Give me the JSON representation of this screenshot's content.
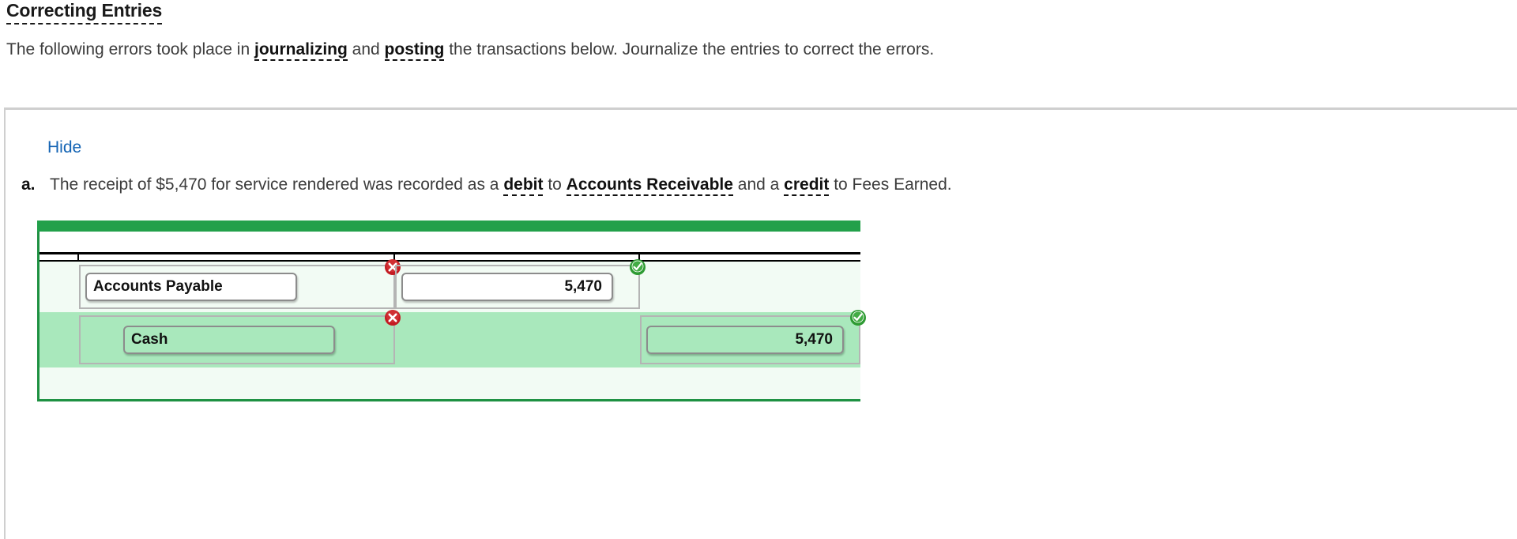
{
  "header": {
    "title": "Correcting Entries",
    "intro_parts": [
      {
        "text": "The following errors took place in ",
        "bold": false
      },
      {
        "text": "journalizing",
        "bold": true
      },
      {
        "text": " and ",
        "bold": false
      },
      {
        "text": "posting",
        "bold": true
      },
      {
        "text": " the transactions below. Journalize the entries to correct the errors.",
        "bold": false
      }
    ]
  },
  "panel": {
    "hide_label": "Hide",
    "item": {
      "marker": "a.",
      "parts": [
        {
          "text": "The receipt of $5,470 for service rendered was recorded as a ",
          "bold": false
        },
        {
          "text": "debit",
          "bold": true
        },
        {
          "text": " to ",
          "bold": false
        },
        {
          "text": "Accounts Receivable",
          "bold": true
        },
        {
          "text": " and a ",
          "bold": false
        },
        {
          "text": "credit",
          "bold": true
        },
        {
          "text": " to Fees Earned.",
          "bold": false
        }
      ]
    }
  },
  "journal": {
    "columns": [
      "",
      "",
      "",
      ""
    ],
    "rows": [
      {
        "date": "",
        "account": "Accounts Payable",
        "account_status": "incorrect",
        "debit": "5,470",
        "debit_status": "correct",
        "credit": "",
        "credit_status": "none",
        "indent": false
      },
      {
        "date": "",
        "account": "Cash",
        "account_status": "incorrect",
        "debit": "",
        "debit_status": "none",
        "credit": "5,470",
        "credit_status": "correct",
        "indent": true
      },
      {
        "date": "",
        "account": "",
        "account_status": "none",
        "debit": "",
        "debit_status": "none",
        "credit": "",
        "credit_status": "none",
        "indent": false
      }
    ]
  },
  "colors": {
    "header_bar": "#22a04a",
    "row_highlight": "#a9e8bc",
    "row_light": "#f2fbf4",
    "link": "#1464b4",
    "status_error": "#cc2222",
    "status_ok": "#2e9b33"
  }
}
